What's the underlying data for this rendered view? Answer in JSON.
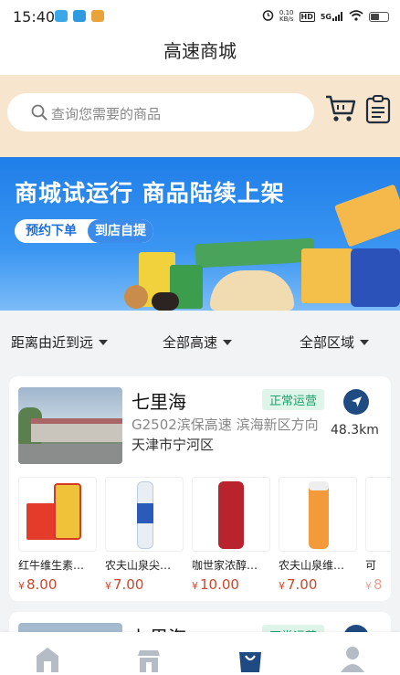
{
  "status_bar": {
    "time": "15:40",
    "net_speed": "0.10",
    "net_unit": "KB/s",
    "hd": "HD",
    "signal": "5G"
  },
  "header": {
    "title": "高速商城"
  },
  "search": {
    "placeholder": "查询您需要的商品"
  },
  "icons": {
    "search": "search-icon",
    "cart": "cart-icon",
    "orders": "clipboard-icon",
    "navigate": "navigation-arrow-icon"
  },
  "banner": {
    "headline": "商城试运行  商品陆续上架",
    "pill_left": "预约下单",
    "pill_right": "到店自提"
  },
  "filters": [
    {
      "label": "距离由近到远"
    },
    {
      "label": "全部高速"
    },
    {
      "label": "全部区域"
    }
  ],
  "stations": [
    {
      "name": "七里海",
      "status": "正常运营",
      "route": "G2502滨保高速 滨海新区方向",
      "city": "天津市宁河区",
      "distance": "48.3km",
      "products": [
        {
          "name": "红牛维生素…",
          "currency": "¥",
          "price": "8.00"
        },
        {
          "name": "农夫山泉尖…",
          "currency": "¥",
          "price": "7.00"
        },
        {
          "name": "咖世家浓醇…",
          "currency": "¥",
          "price": "10.00"
        },
        {
          "name": "农夫山泉维…",
          "currency": "¥",
          "price": "7.00"
        },
        {
          "name": "可",
          "currency": "¥",
          "price": "8"
        }
      ]
    },
    {
      "name": "七里海",
      "status": "正常运营"
    }
  ],
  "colors": {
    "accent": "#1f4b82",
    "price": "#d0452a",
    "status_green": "#1aa06b",
    "search_bg": "#f7e5cd",
    "banner_blue": "#1f7ee8"
  },
  "bottom_nav": [
    {
      "icon": "home-icon"
    },
    {
      "icon": "service-area-icon"
    },
    {
      "icon": "shopping-bag-icon",
      "active": true
    },
    {
      "icon": "user-icon"
    }
  ]
}
